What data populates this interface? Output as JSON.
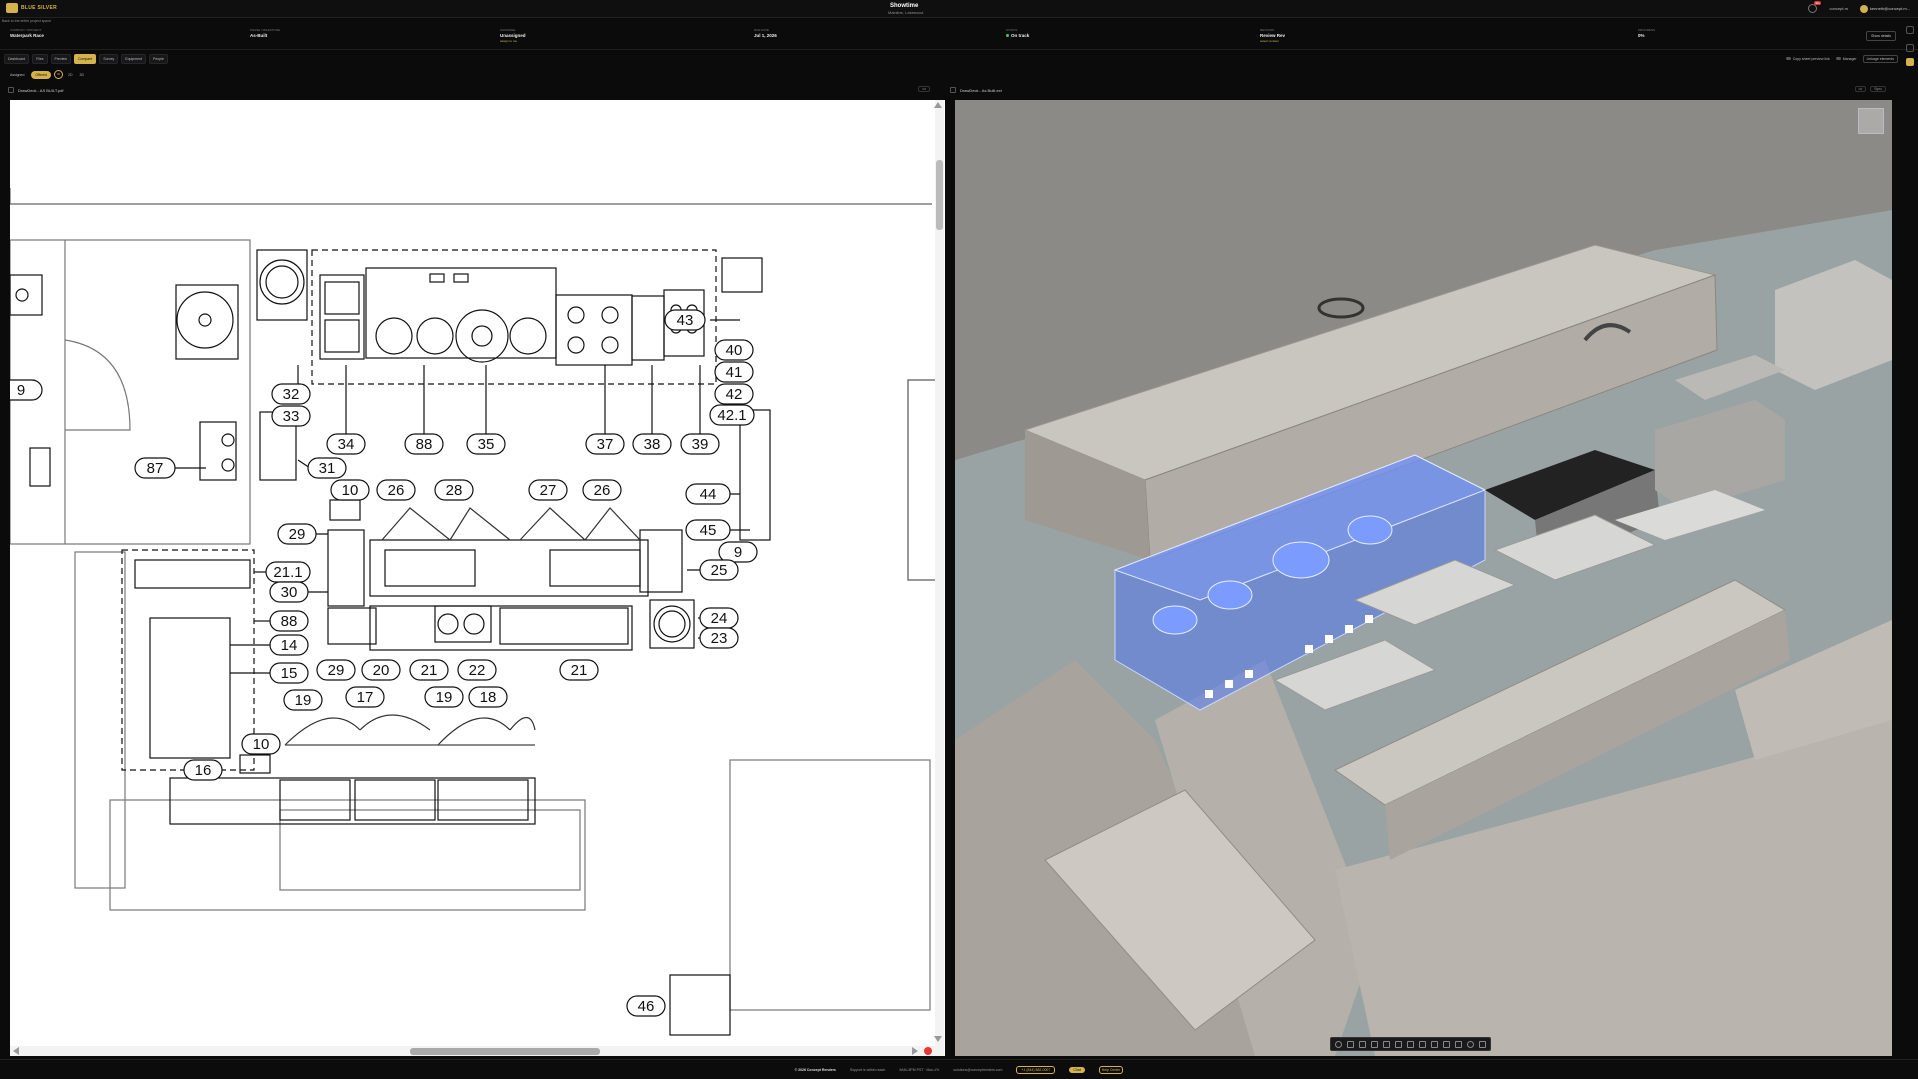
{
  "header": {
    "logo_text": "BLUE SILVER",
    "project_title": "Showtime",
    "project_subtitle": "Mainline, Lakewood",
    "notification_count": "99+",
    "user_short": "concept.m",
    "user_email": "kenneth@concept.m..."
  },
  "back_link": "Back to the entire project space",
  "info": {
    "cells": [
      {
        "label": "Company / Project",
        "value": "Waterpark Race",
        "sub": ""
      },
      {
        "label": "Phase / Milestone",
        "value": "As-Built",
        "sub": ""
      },
      {
        "label": "Assignee",
        "value": "Unassigned",
        "sub": "assign to me"
      },
      {
        "label": "Due Date",
        "value": "Jul 1, 2026",
        "sub": ""
      },
      {
        "label": "Status",
        "value": "On track",
        "sub": ""
      },
      {
        "label": "Revision",
        "value": "Review Rev",
        "sub": "select revision"
      },
      {
        "label": "Progress",
        "value": "0%",
        "sub": ""
      }
    ],
    "edit_label": "Show details"
  },
  "nav": {
    "tabs": [
      "Dashboard",
      "Files",
      "Preview",
      "Compare",
      "Survey",
      "Equipment",
      "People"
    ],
    "active_index": 3,
    "right_items": [
      "Copy sheet preview link",
      "Manager",
      "Linkage elements"
    ]
  },
  "subtabs": {
    "items": [
      "Assigned",
      "Offered"
    ],
    "active_index": 1,
    "icon_labels": [
      "ID",
      "2D",
      "3D"
    ]
  },
  "panels": {
    "left_title": "DrawDeck - AS BUILT.pdf",
    "right_title": "DrawDeck - As Built.ext",
    "left_actions": [
      "•••"
    ],
    "right_actions": [
      "•••",
      "Sync"
    ]
  },
  "drawing_labels": {
    "n43": "43",
    "n40": "40",
    "n41": "41",
    "n42": "42",
    "n42_1": "42.1",
    "n9a": "9",
    "n9b": "9",
    "n32": "32",
    "n33": "33",
    "n34": "34",
    "n88a": "88",
    "n35": "35",
    "n37": "37",
    "n38": "38",
    "n39": "39",
    "n31": "31",
    "n87": "87",
    "n10a": "10",
    "n26a": "26",
    "n28": "28",
    "n27": "27",
    "n26b": "26",
    "n44": "44",
    "n29a": "29",
    "n45": "45",
    "n21_1": "21.1",
    "n30": "30",
    "n25": "25",
    "n88b": "88",
    "n24": "24",
    "n14": "14",
    "n23": "23",
    "n29b": "29",
    "n20": "20",
    "n21a": "21",
    "n22": "22",
    "n21b": "21",
    "n15": "15",
    "n19a": "19",
    "n17": "17",
    "n19b": "19",
    "n18": "18",
    "n10b": "10",
    "n16": "16",
    "n46": "46"
  },
  "footer": {
    "copyright": "© 2026 Concept Renders",
    "support": "Support is within reach",
    "hours": "9AM–5PM PST · Mon–Fri",
    "email": "solutions@conceptrenders.com",
    "phone": "+1 (844) 882-0007",
    "badge1": "Chat",
    "badge2": "Help Center"
  }
}
